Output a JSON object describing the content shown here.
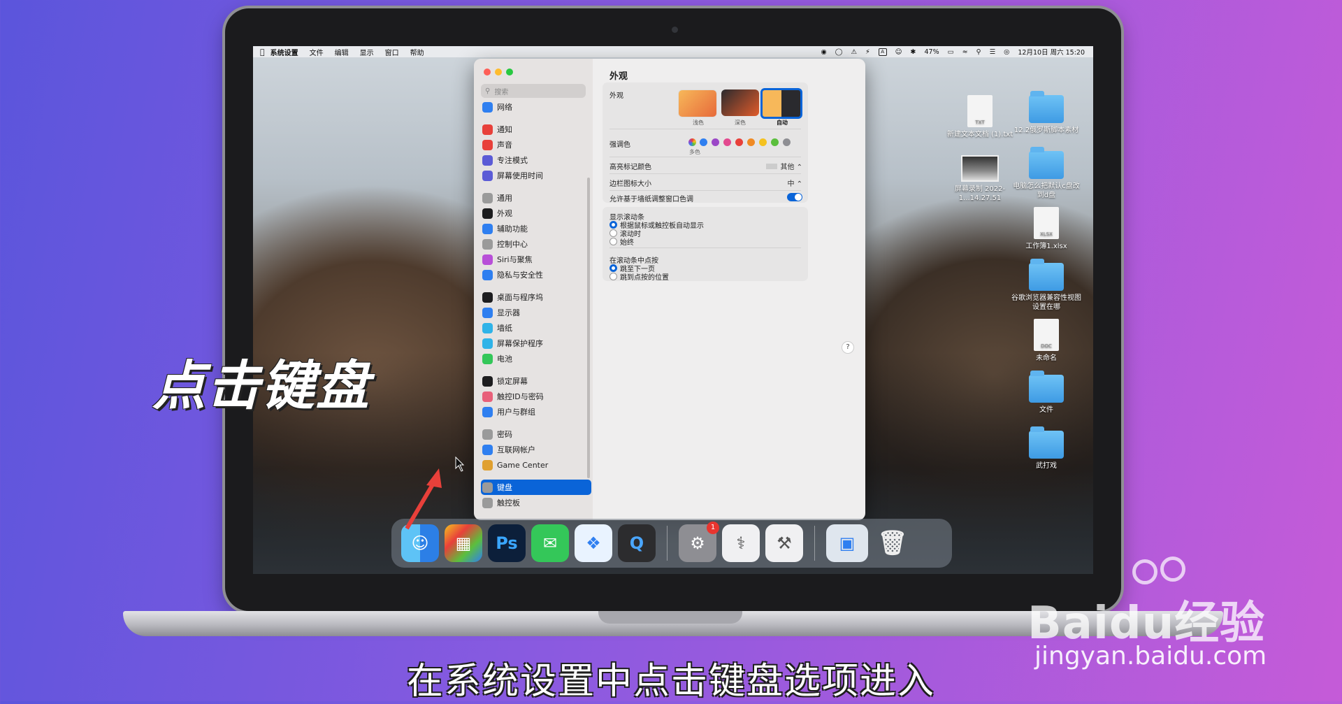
{
  "menubar": {
    "items": [
      "系统设置",
      "文件",
      "编辑",
      "显示",
      "窗口",
      "帮助"
    ],
    "battery": "47%",
    "datetime": "12月10日 周六 15:20"
  },
  "sidebar": {
    "search_placeholder": "搜索",
    "items": [
      {
        "label": "网络",
        "color": "#2f7ff0"
      },
      {
        "label": "通知",
        "color": "#e8403a"
      },
      {
        "label": "声音",
        "color": "#e8403a"
      },
      {
        "label": "专注模式",
        "color": "#5b5bd6"
      },
      {
        "label": "屏幕使用时间",
        "color": "#5b5bd6"
      },
      {
        "label": "通用",
        "color": "#9a9a9a"
      },
      {
        "label": "外观",
        "color": "#1d1d1f"
      },
      {
        "label": "辅助功能",
        "color": "#2f7ff0"
      },
      {
        "label": "控制中心",
        "color": "#9a9a9a"
      },
      {
        "label": "Siri与聚焦",
        "color": "#b84fd8"
      },
      {
        "label": "隐私与安全性",
        "color": "#2f7ff0"
      },
      {
        "label": "桌面与程序坞",
        "color": "#1d1d1f"
      },
      {
        "label": "显示器",
        "color": "#2f7ff0"
      },
      {
        "label": "墙纸",
        "color": "#2fb3e8"
      },
      {
        "label": "屏幕保护程序",
        "color": "#2fb3e8"
      },
      {
        "label": "电池",
        "color": "#34c759"
      },
      {
        "label": "锁定屏幕",
        "color": "#1d1d1f"
      },
      {
        "label": "触控ID与密码",
        "color": "#e8607a"
      },
      {
        "label": "用户与群组",
        "color": "#2f7ff0"
      },
      {
        "label": "密码",
        "color": "#9a9a9a"
      },
      {
        "label": "互联网帐户",
        "color": "#2f7ff0"
      },
      {
        "label": "Game Center",
        "color": "#e0a030"
      },
      {
        "label": "键盘",
        "color": "#9a9a9a"
      },
      {
        "label": "触控板",
        "color": "#9a9a9a"
      }
    ]
  },
  "content": {
    "title": "外观",
    "appearance_label": "外观",
    "modes": [
      "浅色",
      "深色",
      "自动"
    ],
    "accent_label": "强调色",
    "accent_multicolor": "多色",
    "accent_colors": [
      "#2f7ff0",
      "#9b47c7",
      "#e3498f",
      "#e8403a",
      "#f08a24",
      "#f5c220",
      "#5bbf3d",
      "#8e8e93"
    ],
    "highlight_label": "高亮标记颜色",
    "highlight_value": "其他",
    "sidebar_icon_label": "边栏图标大小",
    "sidebar_icon_value": "中",
    "tinting_label": "允许基于墙纸调整窗口色调",
    "scrollbars_label": "显示滚动条",
    "scrollbars_options": [
      "根据鼠标或触控板自动显示",
      "滚动时",
      "始终"
    ],
    "click_label": "在滚动条中点按",
    "click_options": [
      "跳至下一页",
      "跳到点按的位置"
    ],
    "help": "?"
  },
  "desktop": {
    "icons": [
      {
        "label": "新建文本文档 (1).txt",
        "kind": "doc"
      },
      {
        "label": "12.2俄罗斯脚本素材",
        "kind": "folder"
      },
      {
        "label": "屏幕录制 2022-1...14.27.51",
        "kind": "shot"
      },
      {
        "label": "电脑怎么把默认c盘改到d盘",
        "kind": "folder"
      },
      {
        "label": "工作簿1.xlsx",
        "kind": "doc"
      },
      {
        "label": "谷歌浏览器兼容性视图设置在哪",
        "kind": "folder"
      },
      {
        "label": "未命名",
        "kind": "doc"
      },
      {
        "label": "文件",
        "kind": "folder"
      },
      {
        "label": "武打戏",
        "kind": "folder"
      }
    ],
    "doc_badges": [
      "TXT",
      "XLSX",
      "DOC"
    ]
  },
  "dock": {
    "ps_label": "Ps",
    "badge_count": "1"
  },
  "overlay": {
    "caption": "点击键盘",
    "subtitle": "在系统设置中点击键盘选项进入",
    "watermark_logo": "Baidu经验",
    "watermark_url": "jingyan.baidu.com"
  }
}
